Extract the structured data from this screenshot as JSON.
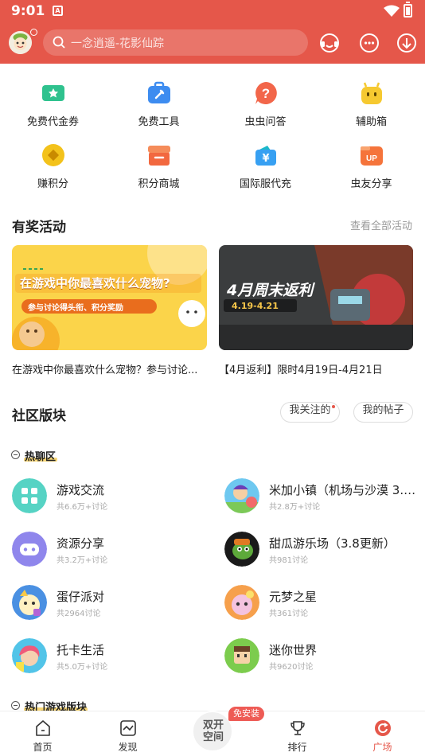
{
  "status_bar": {
    "time": "9:01",
    "notification_icon": "A"
  },
  "header": {
    "search_placeholder": "一念逍遥-花影仙踪",
    "icons": [
      "customer-service-icon",
      "chat-icon",
      "download-icon"
    ]
  },
  "quick_grid": [
    {
      "label": "免费代金券",
      "icon": "voucher-icon",
      "color": "#2fc28e"
    },
    {
      "label": "免费工具",
      "icon": "toolbox-icon",
      "color": "#3d8cf0"
    },
    {
      "label": "虫虫问答",
      "icon": "question-icon",
      "color": "#f2664a"
    },
    {
      "label": "辅助箱",
      "icon": "robot-icon",
      "color": "#f6c930"
    },
    {
      "label": "赚积分",
      "icon": "coin-icon",
      "color": "#f3c21b"
    },
    {
      "label": "积分商城",
      "icon": "shop-icon",
      "color": "#f2683f"
    },
    {
      "label": "国际服代充",
      "icon": "yen-card-icon",
      "color": "#37a0f2"
    },
    {
      "label": "虫友分享",
      "icon": "up-share-icon",
      "color": "#f5743b"
    }
  ],
  "rewards": {
    "title": "有奖活动",
    "more": "查看全部活动",
    "banners": [
      {
        "headline": "在游戏中你最喜欢什么宠物?",
        "tagline": "参与讨论得头衔、积分奖励",
        "caption": "在游戏中你最喜欢什么宠物？参与讨论..."
      },
      {
        "headline": "4月周末返利",
        "dates": "4.19-4.21",
        "caption": "【4月返利】限时4月19日-4月21日"
      }
    ]
  },
  "community": {
    "title": "社区版块",
    "follow_button": "我关注的",
    "posts_button": "我的帖子",
    "hot_section": "热聊区",
    "hot_games_section": "热门游戏版块",
    "forums": [
      {
        "name": "游戏交流",
        "meta": "共6.6万+讨论",
        "icon": "grid-apps-icon"
      },
      {
        "name": "米加小镇（机场与沙漠 3.2...",
        "meta": "共2.8万+讨论",
        "icon": "miga-town-icon"
      },
      {
        "name": "资源分享",
        "meta": "共3.2万+讨论",
        "icon": "gamepad-icon"
      },
      {
        "name": "甜瓜游乐场（3.8更新）",
        "meta": "共981讨论",
        "icon": "melon-playground-icon"
      },
      {
        "name": "蛋仔派对",
        "meta": "共2964讨论",
        "icon": "eggy-party-icon"
      },
      {
        "name": "元梦之星",
        "meta": "共361讨论",
        "icon": "dream-star-icon"
      },
      {
        "name": "托卡生活",
        "meta": "共5.0万+讨论",
        "icon": "toca-life-icon"
      },
      {
        "name": "迷你世界",
        "meta": "共9620讨论",
        "icon": "mini-world-icon"
      }
    ]
  },
  "bottom_nav": {
    "items": [
      {
        "label": "首页",
        "icon": "home-icon"
      },
      {
        "label": "发现",
        "icon": "discover-icon"
      },
      {
        "label": "排行",
        "icon": "trophy-icon"
      },
      {
        "label": "广场",
        "icon": "plaza-icon",
        "active": true
      }
    ],
    "center_label": "双开空间",
    "center_badge": "免安装"
  },
  "colors": {
    "brand": "#e5574a",
    "active_tab": "#e5574a"
  }
}
